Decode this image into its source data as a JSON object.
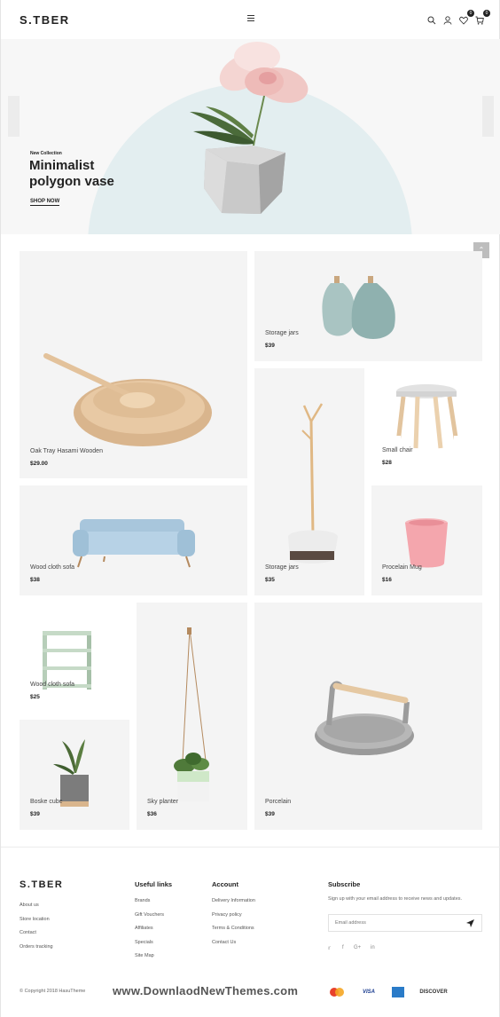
{
  "header": {
    "logo": "S.TBER",
    "icons": [
      "search-icon",
      "user-icon",
      "heart-icon",
      "cart-icon",
      "menu-icon"
    ],
    "wishlist_count": "0",
    "cart_count": "0"
  },
  "hero": {
    "kicker": "New Collection",
    "title": "Minimalist polygon vase",
    "cta": "SHOP NOW",
    "arc_color": "#e3eef0"
  },
  "products": [
    {
      "name": "Oak Tray Hasami Wooden",
      "price": "$29.00"
    },
    {
      "name": "Storage jars",
      "price": "$39"
    },
    {
      "name": "Small chair",
      "price": "$28"
    },
    {
      "name": "Wood cloth sofa",
      "price": "$38"
    },
    {
      "name": "Storage jars",
      "price": "$35"
    },
    {
      "name": "Procelain Mug",
      "price": "$16"
    },
    {
      "name": "Wood cloth sofa",
      "price": "$25"
    },
    {
      "name": "Sky planter",
      "price": "$36"
    },
    {
      "name": "Porcelain",
      "price": "$39"
    },
    {
      "name": "Boske cube",
      "price": "$39"
    }
  ],
  "footer": {
    "logo": "S.TBER",
    "about_links": [
      "About us",
      "Store location",
      "Contact",
      "Orders tracking"
    ],
    "useful_title": "Useful links",
    "useful_links": [
      "Brands",
      "Gift Vouchers",
      "Affiliates",
      "Specials",
      "Site Map"
    ],
    "account_title": "Account",
    "account_links": [
      "Delivery Information",
      "Privacy policy",
      "Terms & Conditions",
      "Contact Us"
    ],
    "subscribe_title": "Subscribe",
    "subscribe_text": "Sign up with your email address to receive news and updates.",
    "email_placeholder": "Email address",
    "social": [
      "twitter-icon",
      "facebook-icon",
      "google-plus-icon",
      "linkedin-icon"
    ],
    "copyright": "© Copyright 2018 HasuTheme",
    "watermark": "www.DownlaodNewThemes.com",
    "payments": [
      "mastercard-icon",
      "VISA",
      "amex-icon",
      "DISCOVER"
    ]
  }
}
